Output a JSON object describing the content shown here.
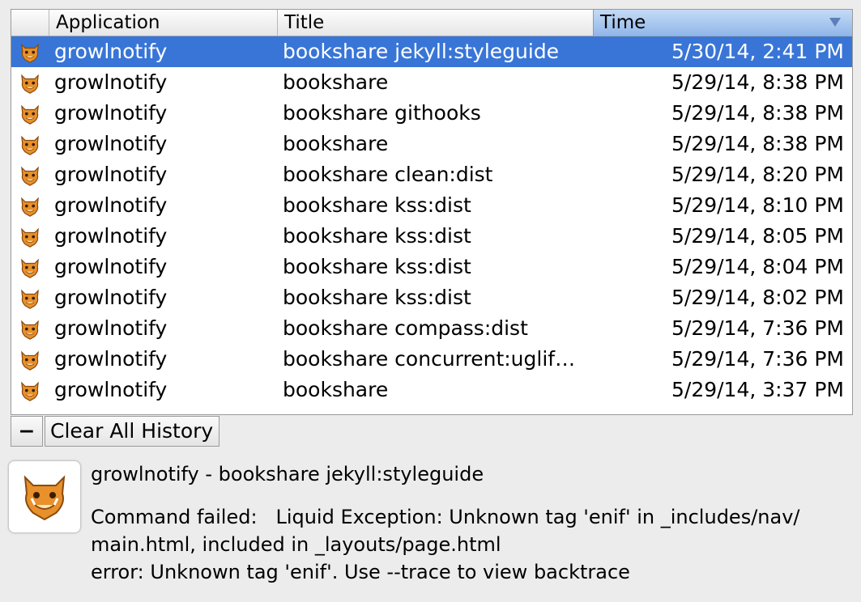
{
  "columns": {
    "application": "Application",
    "title": "Title",
    "time": "Time"
  },
  "rows": [
    {
      "application": "growlnotify",
      "title": "bookshare jekyll:styleguide",
      "time": "5/30/14, 2:41 PM",
      "icon": "growl-icon"
    },
    {
      "application": "growlnotify",
      "title": "bookshare",
      "time": "5/29/14, 8:38 PM",
      "icon": "growl-icon"
    },
    {
      "application": "growlnotify",
      "title": "bookshare githooks",
      "time": "5/29/14, 8:38 PM",
      "icon": "growl-icon"
    },
    {
      "application": "growlnotify",
      "title": "bookshare",
      "time": "5/29/14, 8:38 PM",
      "icon": "growl-icon"
    },
    {
      "application": "growlnotify",
      "title": "bookshare clean:dist",
      "time": "5/29/14, 8:20 PM",
      "icon": "growl-icon"
    },
    {
      "application": "growlnotify",
      "title": "bookshare kss:dist",
      "time": "5/29/14, 8:10 PM",
      "icon": "growl-icon"
    },
    {
      "application": "growlnotify",
      "title": "bookshare kss:dist",
      "time": "5/29/14, 8:05 PM",
      "icon": "growl-icon"
    },
    {
      "application": "growlnotify",
      "title": "bookshare kss:dist",
      "time": "5/29/14, 8:04 PM",
      "icon": "growl-icon"
    },
    {
      "application": "growlnotify",
      "title": "bookshare kss:dist",
      "time": "5/29/14, 8:02 PM",
      "icon": "growl-icon"
    },
    {
      "application": "growlnotify",
      "title": "bookshare compass:dist",
      "time": "5/29/14, 7:36 PM",
      "icon": "growl-icon"
    },
    {
      "application": "growlnotify",
      "title": "bookshare concurrent:uglif…",
      "time": "5/29/14, 7:36 PM",
      "icon": "growl-icon"
    },
    {
      "application": "growlnotify",
      "title": "bookshare",
      "time": "5/29/14, 3:37 PM",
      "icon": "growl-icon"
    }
  ],
  "selected_index": 0,
  "toolbar": {
    "minus_label": "−",
    "clear_label": "Clear All History"
  },
  "detail": {
    "icon": "growl-icon",
    "title": "growlnotify - bookshare jekyll:styleguide",
    "message": "Command failed:   Liquid Exception: Unknown tag 'enif' in _includes/nav/\nmain.html, included in _layouts/page.html\nerror: Unknown tag 'enif'. Use --trace to view backtrace"
  },
  "colors": {
    "selection": "#3875d7",
    "sorted_header": "#90b6e8",
    "growl_orange": "#e8902a"
  }
}
